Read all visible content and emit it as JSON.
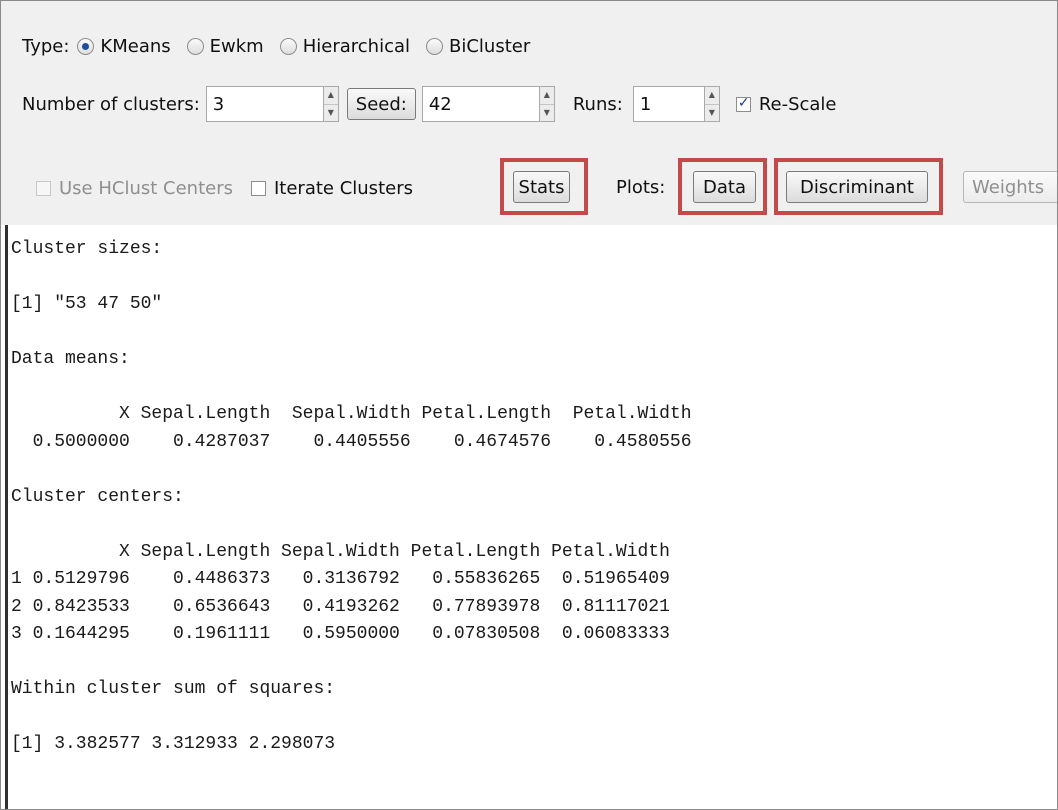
{
  "type_row": {
    "label": "Type:",
    "options": [
      {
        "label": "KMeans",
        "selected": true
      },
      {
        "label": "Ewkm",
        "selected": false
      },
      {
        "label": "Hierarchical",
        "selected": false
      },
      {
        "label": "BiCluster",
        "selected": false
      }
    ]
  },
  "params_row": {
    "clusters_label": "Number of clusters:",
    "clusters_value": "3",
    "seed_button": "Seed:",
    "seed_value": "42",
    "runs_label": "Runs:",
    "runs_value": "1",
    "rescale_label": "Re-Scale",
    "rescale_checked": true
  },
  "actions_row": {
    "hclust_label": "Use HClust Centers",
    "hclust_enabled": false,
    "iterate_label": "Iterate Clusters",
    "stats_button": "Stats",
    "plots_label": "Plots:",
    "data_button": "Data",
    "discriminant_button": "Discriminant",
    "weights_button": "Weights"
  },
  "highlight_color": "#c44a4a",
  "output_lines": [
    "Cluster sizes:",
    "",
    "[1] \"53 47 50\"",
    "",
    "Data means:",
    "",
    "          X Sepal.Length  Sepal.Width Petal.Length  Petal.Width",
    "  0.5000000    0.4287037    0.4405556    0.4674576    0.4580556",
    "",
    "Cluster centers:",
    "",
    "          X Sepal.Length Sepal.Width Petal.Length Petal.Width",
    "1 0.5129796    0.4486373   0.3136792   0.55836265  0.51965409",
    "2 0.8423533    0.6536643   0.4193262   0.77893978  0.81117021",
    "3 0.1644295    0.1961111   0.5950000   0.07830508  0.06083333",
    "",
    "Within cluster sum of squares:",
    "",
    "[1] 3.382577 3.312933 2.298073"
  ]
}
